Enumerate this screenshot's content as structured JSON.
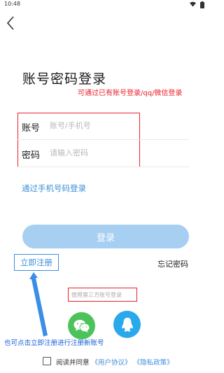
{
  "status_bar": {
    "time": "10:48"
  },
  "header": {
    "title": "账号密码登录"
  },
  "annotations": {
    "login_note": "可通过已有账号登录/qq/微信登录",
    "register_note": "也可点击立即注册进行注册新账号"
  },
  "form": {
    "account_label": "账号",
    "account_placeholder": "账号/手机号",
    "password_label": "密码",
    "password_placeholder": "请输入密码"
  },
  "links": {
    "phone_login": "通过手机号码登录",
    "register": "立即注册",
    "forgot_password": "忘记密码"
  },
  "login_button": "登录",
  "third_party": {
    "label": "使用第三方账号登录"
  },
  "agreement": {
    "prefix": "阅读并同意",
    "user_agreement": "《用户协议》",
    "privacy_policy": "《隐私政策》"
  },
  "colors": {
    "annotation_red": "#e8212c",
    "link_blue": "#3d8fd8",
    "button_disabled": "#a6cff2",
    "wechat_green": "#4cc35a",
    "qq_blue": "#29a8ec"
  },
  "icons": [
    "back-arrow-icon",
    "wifi-icon",
    "battery-icon",
    "wechat-icon",
    "qq-icon"
  ]
}
